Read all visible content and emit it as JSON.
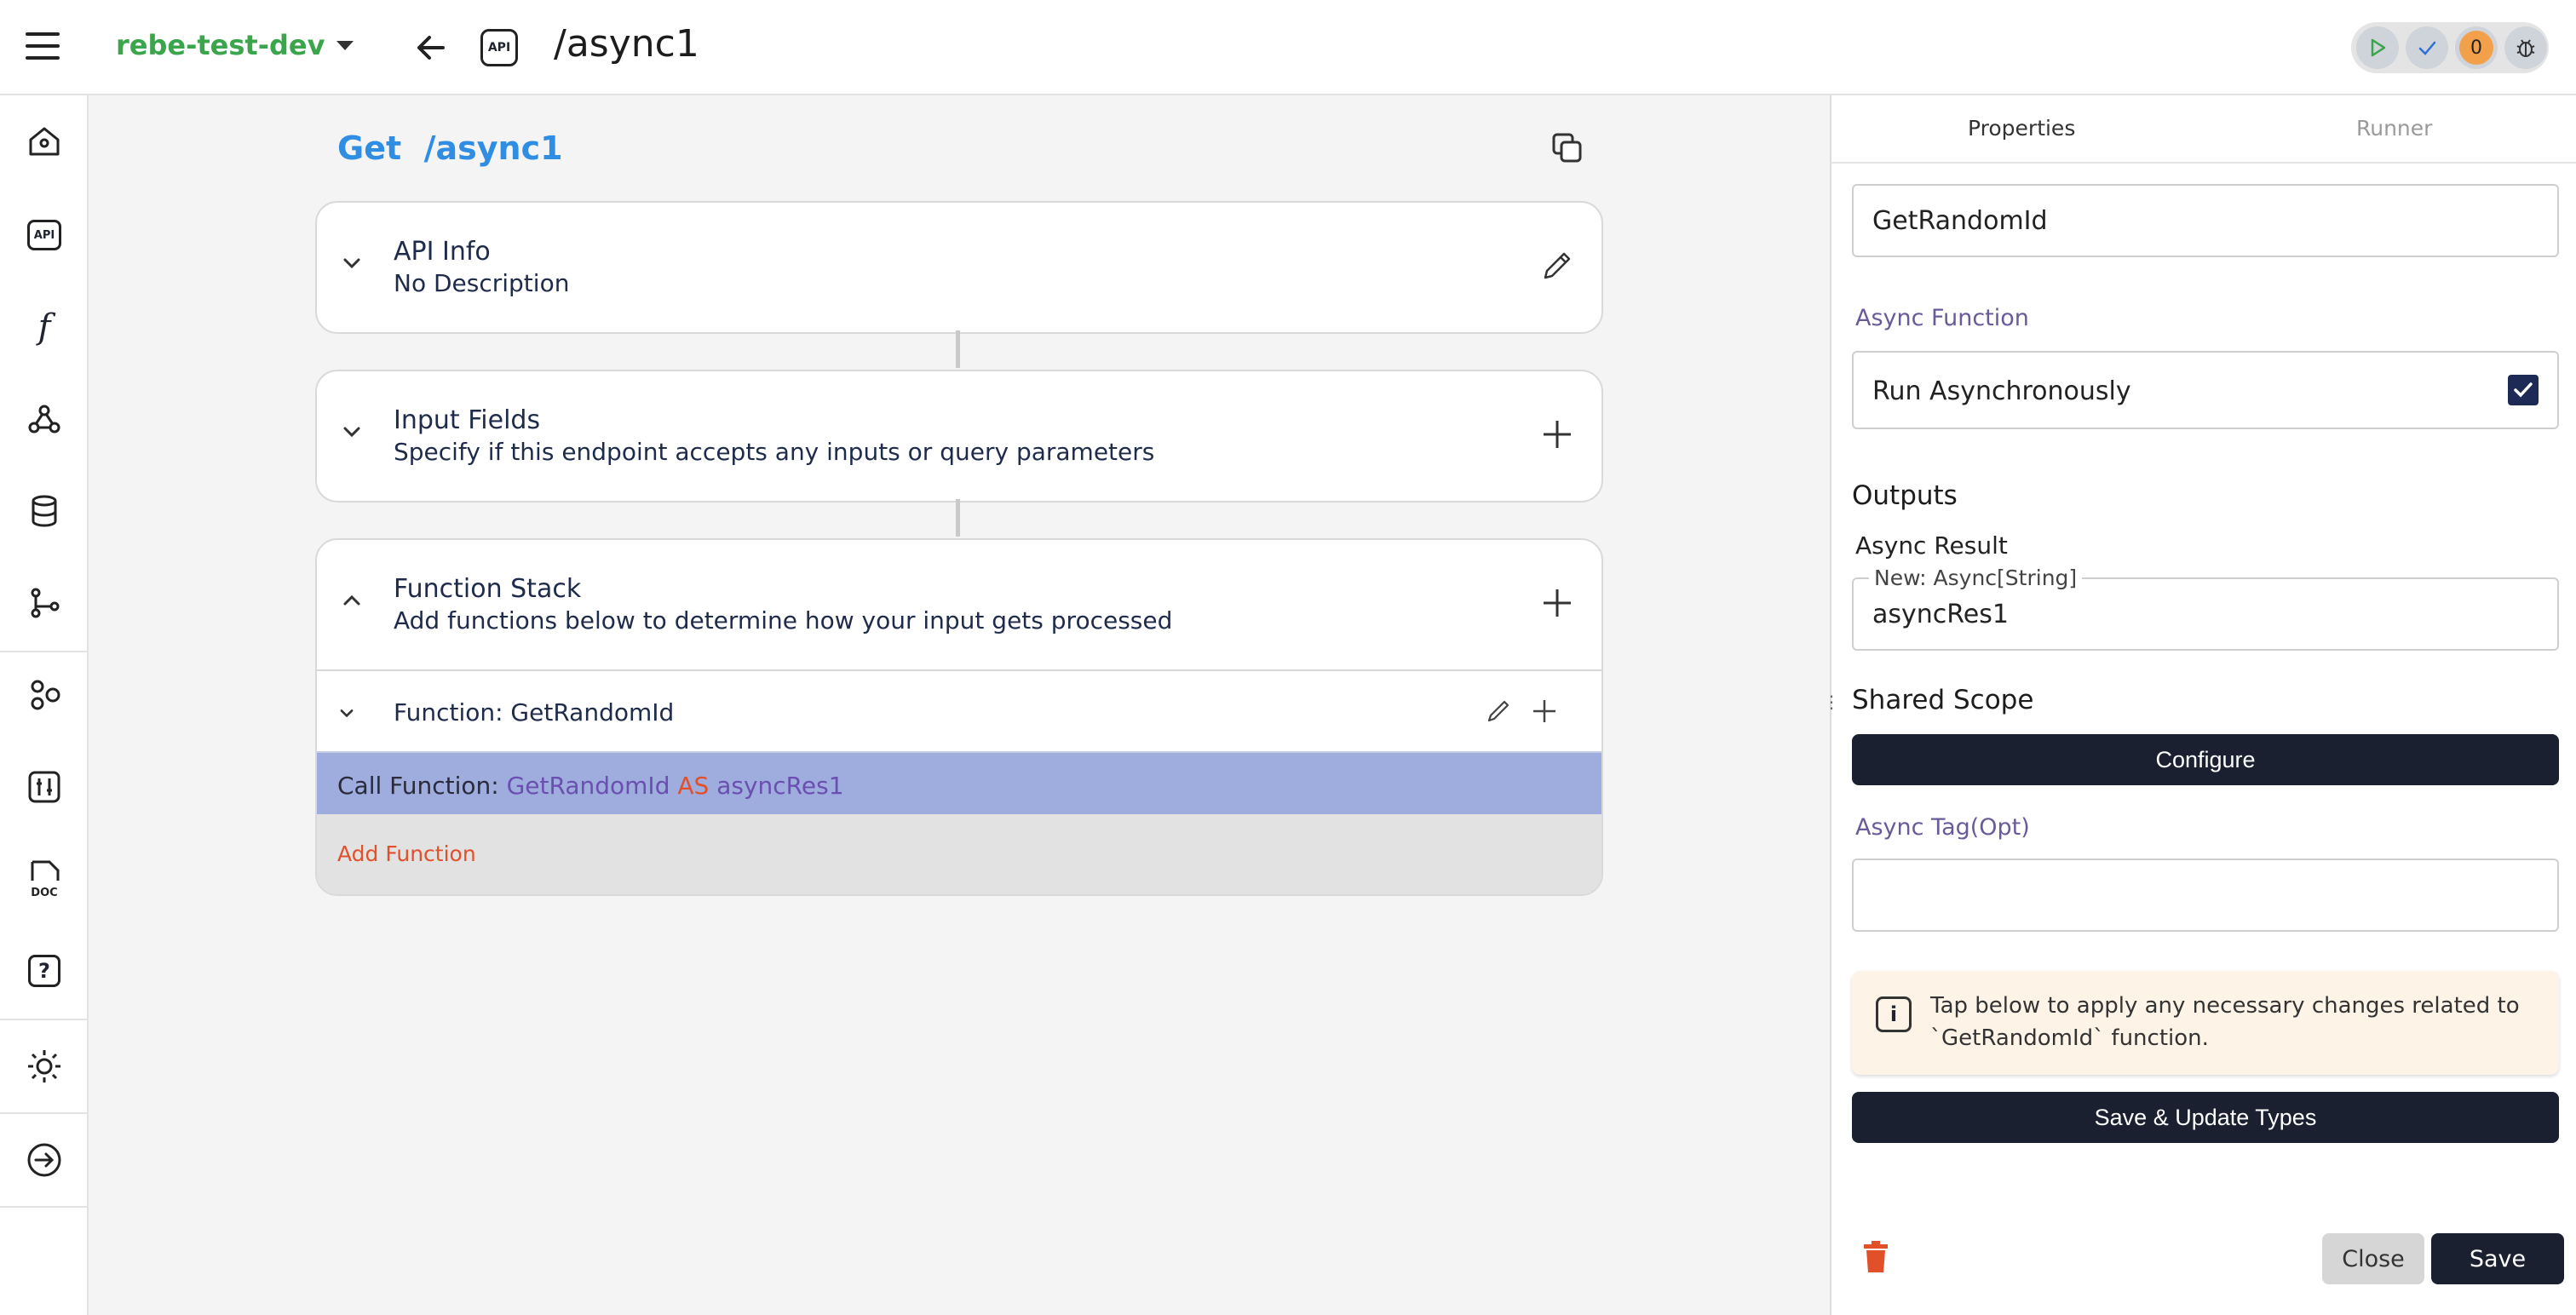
{
  "header": {
    "menu_icon": "hamburger-icon",
    "project_name": "rebe-test-dev",
    "back_icon": "arrow-left-icon",
    "api_badge": "API",
    "path": "/async1",
    "status": {
      "run_icon": "play-icon",
      "check_icon": "check-icon",
      "issue_count": "0",
      "debug_icon": "bug-icon"
    }
  },
  "sidebar": {
    "items": [
      {
        "icon": "home-icon"
      },
      {
        "icon": "api-icon",
        "text": "API"
      },
      {
        "icon": "function-icon",
        "text": "f"
      },
      {
        "icon": "webhook-icon"
      },
      {
        "icon": "database-icon"
      },
      {
        "icon": "git-branch-icon"
      },
      {
        "icon": "shapes-icon"
      },
      {
        "icon": "tools-icon"
      },
      {
        "icon": "doc-icon",
        "text": "DOC"
      },
      {
        "icon": "help-icon",
        "text": "?"
      },
      {
        "icon": "theme-sun-icon"
      },
      {
        "icon": "logout-icon"
      }
    ]
  },
  "main": {
    "method": "Get",
    "path": "/async1",
    "api_info": {
      "title": "API Info",
      "subtitle": "No Description"
    },
    "input_fields": {
      "title": "Input Fields",
      "subtitle": "Specify if this endpoint accepts any inputs or query parameters"
    },
    "function_stack": {
      "title": "Function Stack",
      "subtitle": "Add functions below to determine how your input gets processed",
      "function_label": "Function: GetRandomId",
      "call": {
        "prefix": "Call Function:",
        "function": "GetRandomId",
        "keyword": "AS",
        "variable": "asyncRes1"
      },
      "add_function": "Add Function"
    }
  },
  "panel": {
    "tabs": [
      {
        "label": "Properties"
      },
      {
        "label": "Runner"
      }
    ],
    "function_name": "GetRandomId",
    "async_function_label": "Async Function",
    "run_async_label": "Run Asynchronously",
    "run_async_checked": true,
    "outputs_title": "Outputs",
    "async_result_label": "Async Result",
    "async_result_legend": "New: Async[String]",
    "async_result_value": "asyncRes1",
    "shared_scope_title": "Shared Scope",
    "configure_label": "Configure",
    "async_tag_label": "Async Tag(Opt)",
    "async_tag_value": "",
    "info_text": "Tap below to apply any necessary changes related to `GetRandomId` function.",
    "save_update_label": "Save & Update Types",
    "close_label": "Close",
    "save_label": "Save"
  },
  "colors": {
    "project": "#3aa54a",
    "method": "#2f8de4",
    "call_row": "#9fadde",
    "keyword": "#e2502a",
    "accent_purple": "#6b4fb0",
    "dark_button": "#1b2030",
    "info_bg": "#fdf3e7",
    "trash": "#e2502a"
  }
}
